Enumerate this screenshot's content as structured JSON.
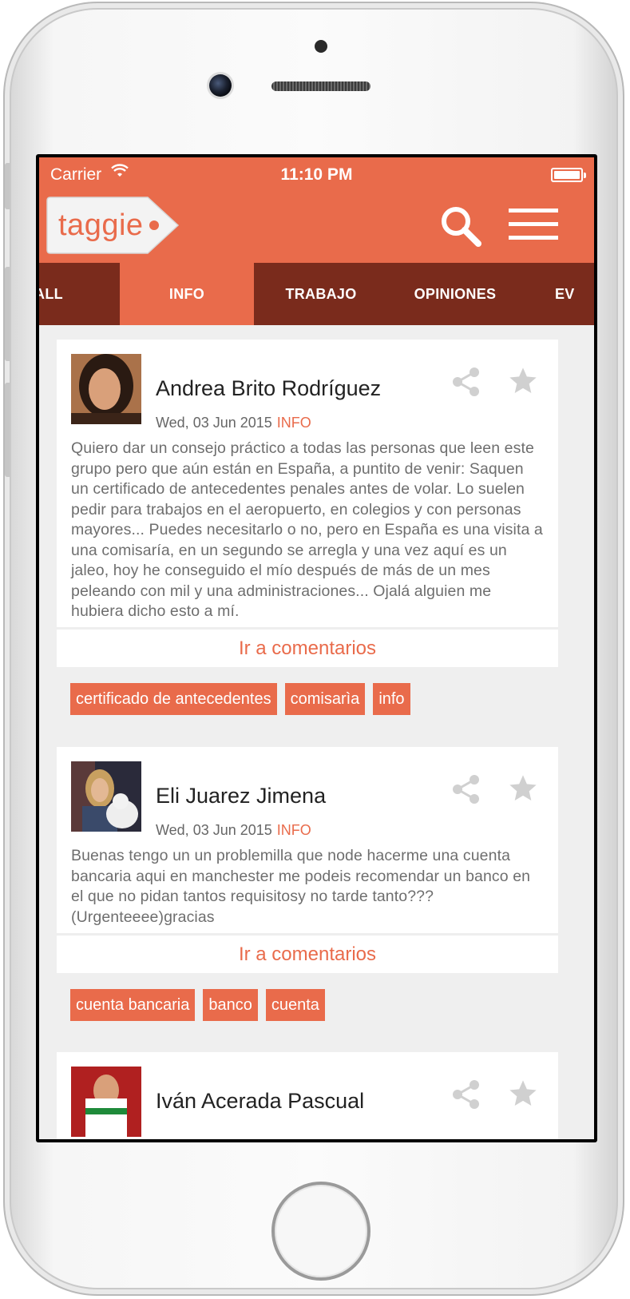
{
  "status_bar": {
    "carrier": "Carrier",
    "time": "11:10 PM"
  },
  "app": {
    "logo_text": "taggie"
  },
  "tabs": [
    {
      "label": "ALL"
    },
    {
      "label": "INFO",
      "active": true
    },
    {
      "label": "TRABAJO"
    },
    {
      "label": "OPINIONES"
    },
    {
      "label": "EV"
    }
  ],
  "posts": [
    {
      "author": "Andrea Brito Rodríguez",
      "date": "Wed, 03 Jun 2015",
      "category": "INFO",
      "text": "Quiero dar un consejo práctico a todas las personas que leen este grupo pero que aún están en España, a puntito de venir: Saquen un certificado de antecedentes penales antes de volar. Lo suelen pedir para trabajos en el aeropuerto, en colegios y con personas mayores... Puedes necesitarlo o no, pero en España es una visita a una comisaría, en un segundo se arregla y una vez aquí es un jaleo, hoy he conseguido el mío después de más de un mes peleando con mil y una administraciones... Ojalá alguien me hubiera dicho esto a mí.",
      "comments_label": "Ir a comentarios",
      "tags": [
        "certificado de antecedentes",
        "comisarìa",
        "info"
      ]
    },
    {
      "author": "Eli Juarez Jimena",
      "date": "Wed, 03 Jun 2015",
      "category": "INFO",
      "text": "Buenas tengo un un problemilla que node hacerme una cuenta bancaria aqui en manchester me podeis recomendar un banco en el que no pidan tantos requisitosy no tarde tanto??? (Urgenteeee)gracias",
      "comments_label": "Ir a comentarios",
      "tags": [
        "cuenta bancaria",
        "banco",
        "cuenta"
      ]
    },
    {
      "author": "Iván Acerada Pascual"
    }
  ],
  "colors": {
    "accent": "#e96b4b",
    "tab_bar": "#7a2b1c",
    "background": "#efefef"
  },
  "icons": [
    "wifi-icon",
    "battery-icon",
    "search-icon",
    "menu-icon",
    "share-icon",
    "star-icon"
  ]
}
